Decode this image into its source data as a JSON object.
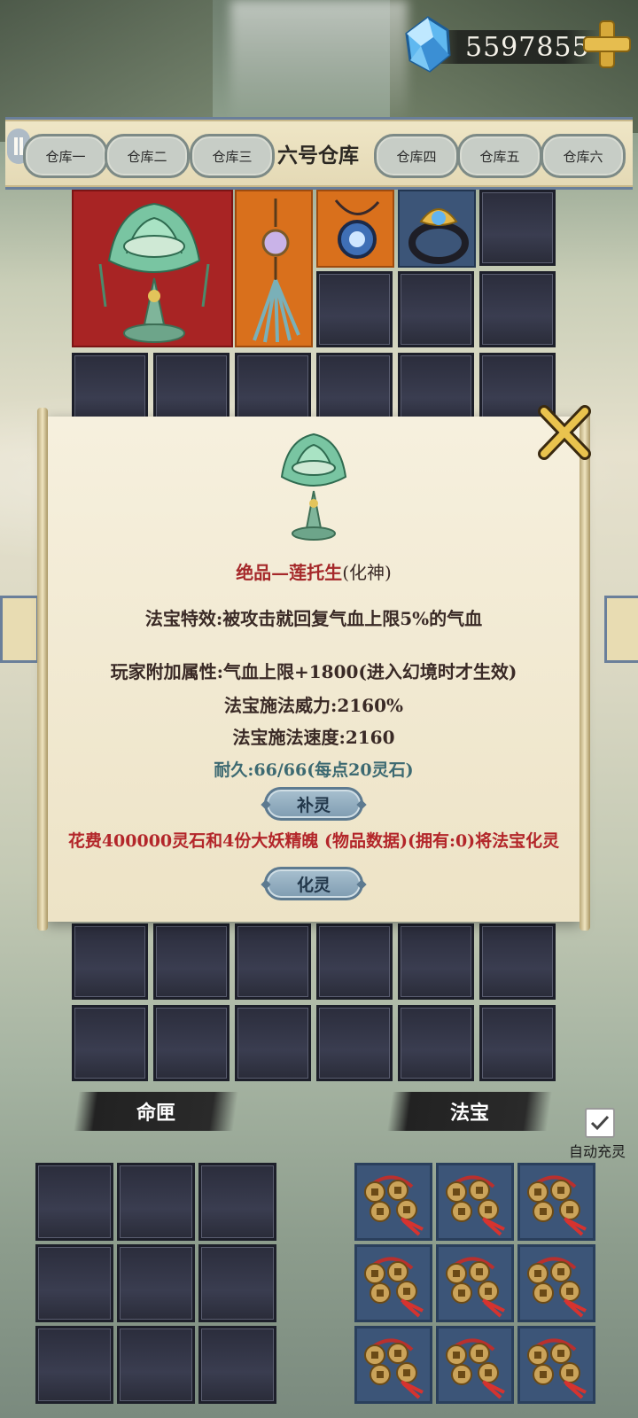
{
  "currency": {
    "value": "5597855",
    "gem_icon": "spirit-stone-icon",
    "plus_icon": "plus-icon"
  },
  "warehouse_tabs": [
    {
      "label": "仓库一",
      "active": false
    },
    {
      "label": "仓库二",
      "active": false
    },
    {
      "label": "仓库三",
      "active": false
    },
    {
      "label": "六号仓库",
      "active": true
    },
    {
      "label": "仓库四",
      "active": false
    },
    {
      "label": "仓库五",
      "active": false
    },
    {
      "label": "仓库六",
      "active": false
    }
  ],
  "grid_items": [
    {
      "name": "lotus-treasure",
      "quality_color": "#a82424"
    },
    {
      "name": "tassel-pendant",
      "quality_color": "#d9701c"
    },
    {
      "name": "amulet-necklace",
      "quality_color": "#d9701c"
    },
    {
      "name": "lotus-ring",
      "quality_color": "#3c5578"
    }
  ],
  "popup": {
    "item_name": "绝品—莲托生",
    "item_realm": "(化神)",
    "effect": "法宝特效:被攻击就回复气血上限5%的气血",
    "player_attr": "玩家附加属性:气血上限+1800(进入幻境时才生效)",
    "cast_power": "法宝施法威力:2160%",
    "cast_speed": "法宝施法速度:2160",
    "durability": "耐久:66/66(每点20灵石)",
    "replenish_button": "补灵",
    "cost_text": "花费400000灵石和4份大妖精魄 (物品数据)(拥有:0)将法宝化灵",
    "transform_button": "化灵",
    "close_icon": "close-x-icon"
  },
  "bottom": {
    "fate_box_label": "命匣",
    "treasure_label": "法宝",
    "auto_refill_label": "自动充灵",
    "auto_refill_checked": true
  },
  "colors": {
    "red_item": "#a82424",
    "orange_item": "#d9701c",
    "blue_item": "#3c5578",
    "cost_red": "#b3262a"
  }
}
